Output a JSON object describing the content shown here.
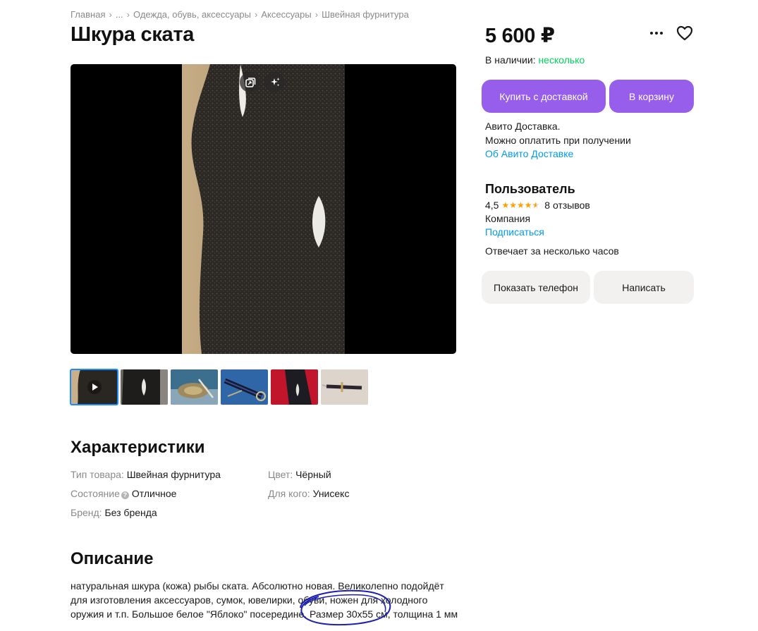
{
  "breadcrumb": {
    "items": [
      "Главная",
      "...",
      "Одежда, обувь, аксессуары",
      "Аксессуары",
      "Швейная фурнитура"
    ],
    "separator": "›"
  },
  "listing": {
    "title": "Шкура ската",
    "price": "5 600 ₽",
    "stock_label": "В наличии:",
    "stock_value": "несколько"
  },
  "gallery": {
    "icons": [
      "gallery-stack-icon",
      "sparkles-icon"
    ],
    "thumbnails_count": 6,
    "thumb_icons": [
      "play-icon"
    ]
  },
  "actions": {
    "buy_delivery": "Купить с доставкой",
    "add_to_cart": "В корзину",
    "show_phone": "Показать телефон",
    "write": "Написать"
  },
  "delivery": {
    "line1": "Авито Доставка.",
    "line2": "Можно оплатить при получении",
    "link": "Об Авито Доставке"
  },
  "seller": {
    "name": "Пользователь",
    "rating": "4,5",
    "reviews": "8 отзывов",
    "type": "Компания",
    "subscribe": "Подписаться",
    "response_time": "Отвечает за несколько часов"
  },
  "characteristics": {
    "heading": "Характеристики",
    "items": [
      {
        "key": "Тип товара:",
        "value": "Швейная фурнитура"
      },
      {
        "key": "Цвет:",
        "value": "Чёрный"
      },
      {
        "key": "Состояние",
        "value": "Отличное"
      },
      {
        "key": "Для кого:",
        "value": "Унисекс"
      },
      {
        "key": "Бренд:",
        "value": "Без бренда"
      }
    ]
  },
  "description": {
    "heading": "Описание",
    "lines": [
      "натуральная шкура (кожа) рыбы ската. Абсолютно новая. Великолепно подойдёт",
      "для изготовления аксессуаров, сумок, ювелирки, обуви, ножен для холодного",
      "оружия и т.п. Большое белое \"Яблоко\" посередине. Размер 30х55 см, толщина 1 мм"
    ]
  },
  "colors": {
    "accent_purple": "#965eeb",
    "link_blue": "#0099f7",
    "stock_green": "#02d15c",
    "star_orange": "#ffa000",
    "thumb_active_outline": "#1a8cff",
    "annotation_ink": "#1b1fb0"
  }
}
